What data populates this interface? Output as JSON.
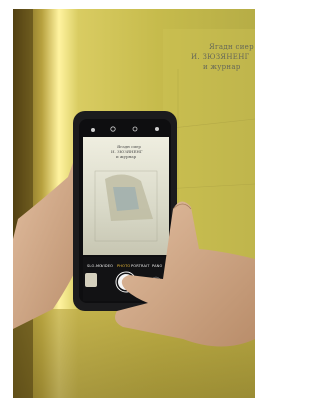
{
  "scene": {
    "wall_sign_lines": [
      "Ягадн сиер",
      "И. ЗЮЗЯНЕНГ",
      "и журнар"
    ],
    "phone_screen_lines": [
      "Ягадн сиер",
      "И. ЗЮЗЯНЕНГ",
      "и журнар"
    ],
    "camera_modes": [
      {
        "label": "SLO-MO",
        "active": false
      },
      {
        "label": "VIDEO",
        "active": false
      },
      {
        "label": "PHOTO",
        "active": true
      },
      {
        "label": "PORTRAIT",
        "active": false
      },
      {
        "label": "PANO",
        "active": false
      }
    ]
  },
  "colors": {
    "wall": "#c6bb4c",
    "wall_shadow": "#6f5a1a",
    "light_glow": "#fff6a6",
    "phone_body": "#1b1b1d",
    "skin": "#d7b08f",
    "active_mode": "#f3c23a"
  }
}
